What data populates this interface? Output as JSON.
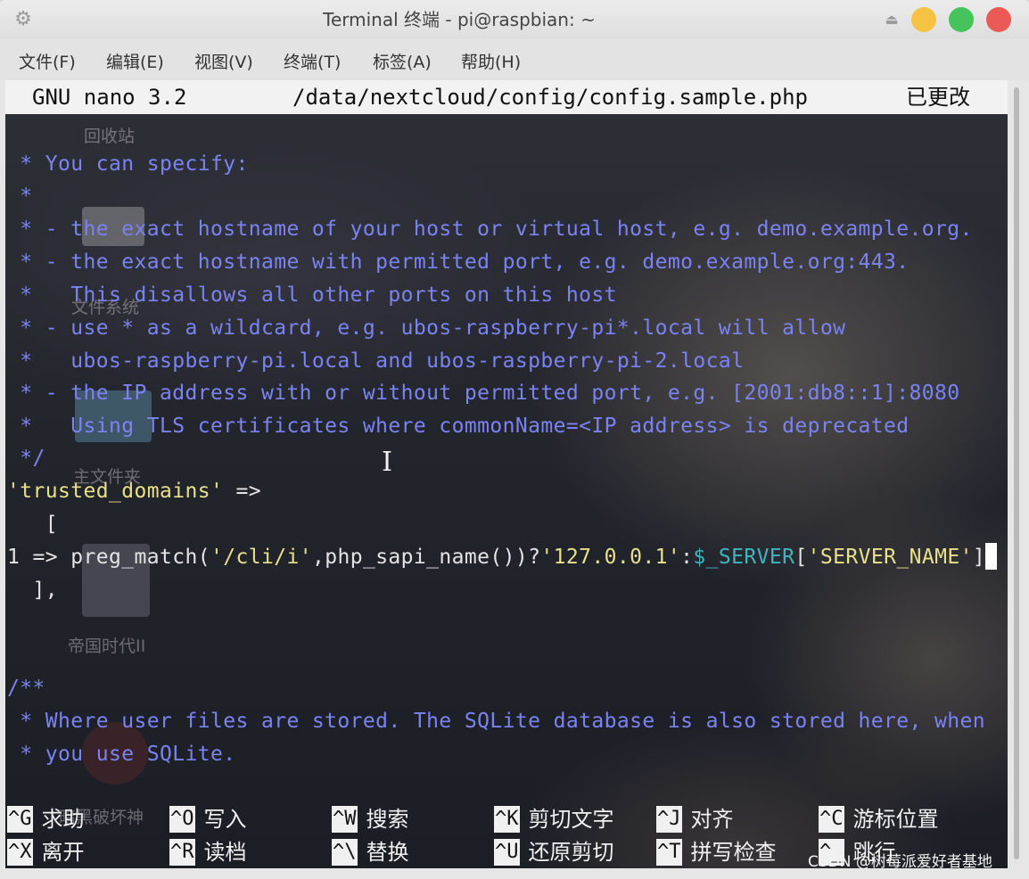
{
  "window": {
    "title": "Terminal 终端 - pi@raspbian: ~",
    "buttons": {
      "minimize_color": "#f5c242",
      "maximize_color": "#46c35a",
      "close_color": "#ec5a55"
    }
  },
  "menu": [
    {
      "label": "文件(F)"
    },
    {
      "label": "编辑(E)"
    },
    {
      "label": "视图(V)"
    },
    {
      "label": "终端(T)"
    },
    {
      "label": "标签(A)"
    },
    {
      "label": "帮助(H)"
    }
  ],
  "nano": {
    "version": "GNU nano 3.2",
    "file": "/data/nextcloud/config/config.sample.php",
    "modified": "已更改"
  },
  "lines": {
    "l1": " * You can specify:",
    "l2": " *",
    "l3": " * - the exact hostname of your host or virtual host, e.g. demo.example.org.",
    "l4": " * - the exact hostname with permitted port, e.g. demo.example.org:443.",
    "l5": " *   This disallows all other ports on this host",
    "l6": " * - use * as a wildcard, e.g. ubos-raspberry-pi*.local will allow",
    "l7": " *   ubos-raspberry-pi.local and ubos-raspberry-pi-2.local",
    "l8": " * - the IP address with or without permitted port, e.g. [2001:db8::1]:8080",
    "l9": " *   Using TLS certificates where commonName=<IP address> is deprecated",
    "l10": " */",
    "l11_str": "'trusted_domains'",
    "l11_op": " =>",
    "l12": "   [",
    "l13_a": "1 => preg_match(",
    "l13_b": "'/cli/i'",
    "l13_c": ",php_sapi_name())?",
    "l13_d": "'127.0.0.1'",
    "l13_e": ":",
    "l13_f": "$_SERVER",
    "l13_g": "[",
    "l13_h": "'SERVER_NAME'",
    "l13_i": "]",
    "l14": "  ],",
    "l15": "/**",
    "l16": " * Where user files are stored. The SQLite database is also stored here, when",
    "l17": " * you use SQLite."
  },
  "desktop": {
    "trash": "回收站",
    "filesystem": "文件系统",
    "home": "主文件夹",
    "aoe": "帝国时代II",
    "diablo": "暗黑破坏神"
  },
  "shortcuts": [
    {
      "key": "^G",
      "label": "求助"
    },
    {
      "key": "^O",
      "label": "写入"
    },
    {
      "key": "^W",
      "label": "搜索"
    },
    {
      "key": "^K",
      "label": "剪切文字"
    },
    {
      "key": "^J",
      "label": "对齐"
    },
    {
      "key": "^C",
      "label": "游标位置"
    },
    {
      "key": "^X",
      "label": "离开"
    },
    {
      "key": "^R",
      "label": "读档"
    },
    {
      "key": "^\\",
      "label": "替换"
    },
    {
      "key": "^U",
      "label": "还原剪切"
    },
    {
      "key": "^T",
      "label": "拼写检查"
    },
    {
      "key": "^_",
      "label": "跳行"
    }
  ],
  "watermark": "CSDN @树莓派爱好者基地"
}
